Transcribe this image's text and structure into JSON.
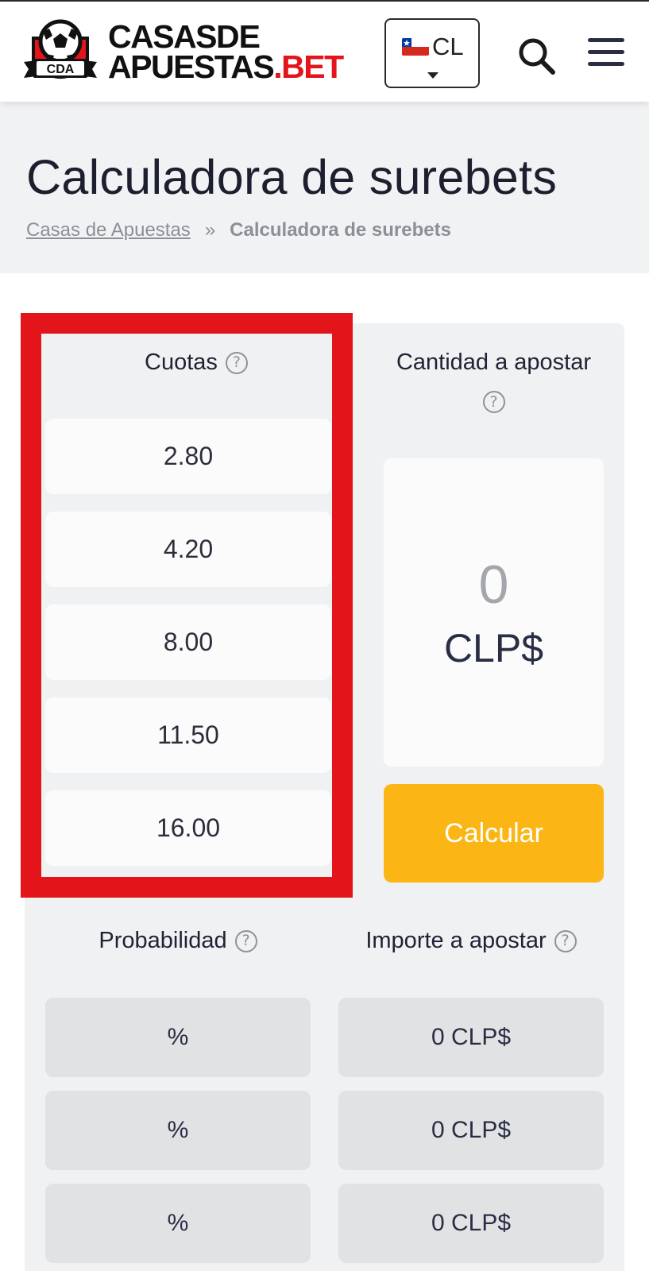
{
  "header": {
    "logo": {
      "badge_text": "CDA",
      "line1_a": "CASAS",
      "line1_b": "DE",
      "line2_a": "APUESTAS",
      "line2_b": ".BET",
      "brand_red": "#e3141c"
    },
    "country": {
      "code": "CL",
      "flag": "chile-flag-icon"
    },
    "search_icon": "search-icon",
    "menu_icon": "hamburger-menu-icon"
  },
  "page": {
    "title": "Calculadora de surebets",
    "breadcrumb": {
      "home": "Casas de Apuestas",
      "separator": "»",
      "current": "Calculadora de surebets"
    }
  },
  "calculator": {
    "odds_header": "Cuotas",
    "stake_header": "Cantidad a apostar",
    "help_glyph": "?",
    "odds": [
      "2.80",
      "4.20",
      "8.00",
      "11.50",
      "16.00"
    ],
    "stake_value": "0",
    "stake_currency": "CLP$",
    "calculate_label": "Calcular",
    "probability_header": "Probabilidad",
    "amount_header": "Importe a apostar",
    "results": [
      {
        "probability": "%",
        "amount": "0 CLP$"
      },
      {
        "probability": "%",
        "amount": "0 CLP$"
      },
      {
        "probability": "%",
        "amount": "0 CLP$"
      }
    ]
  },
  "colors": {
    "accent_button": "#fbb616",
    "highlight_frame": "#e3151a",
    "panel_bg": "#f0f1f3"
  }
}
